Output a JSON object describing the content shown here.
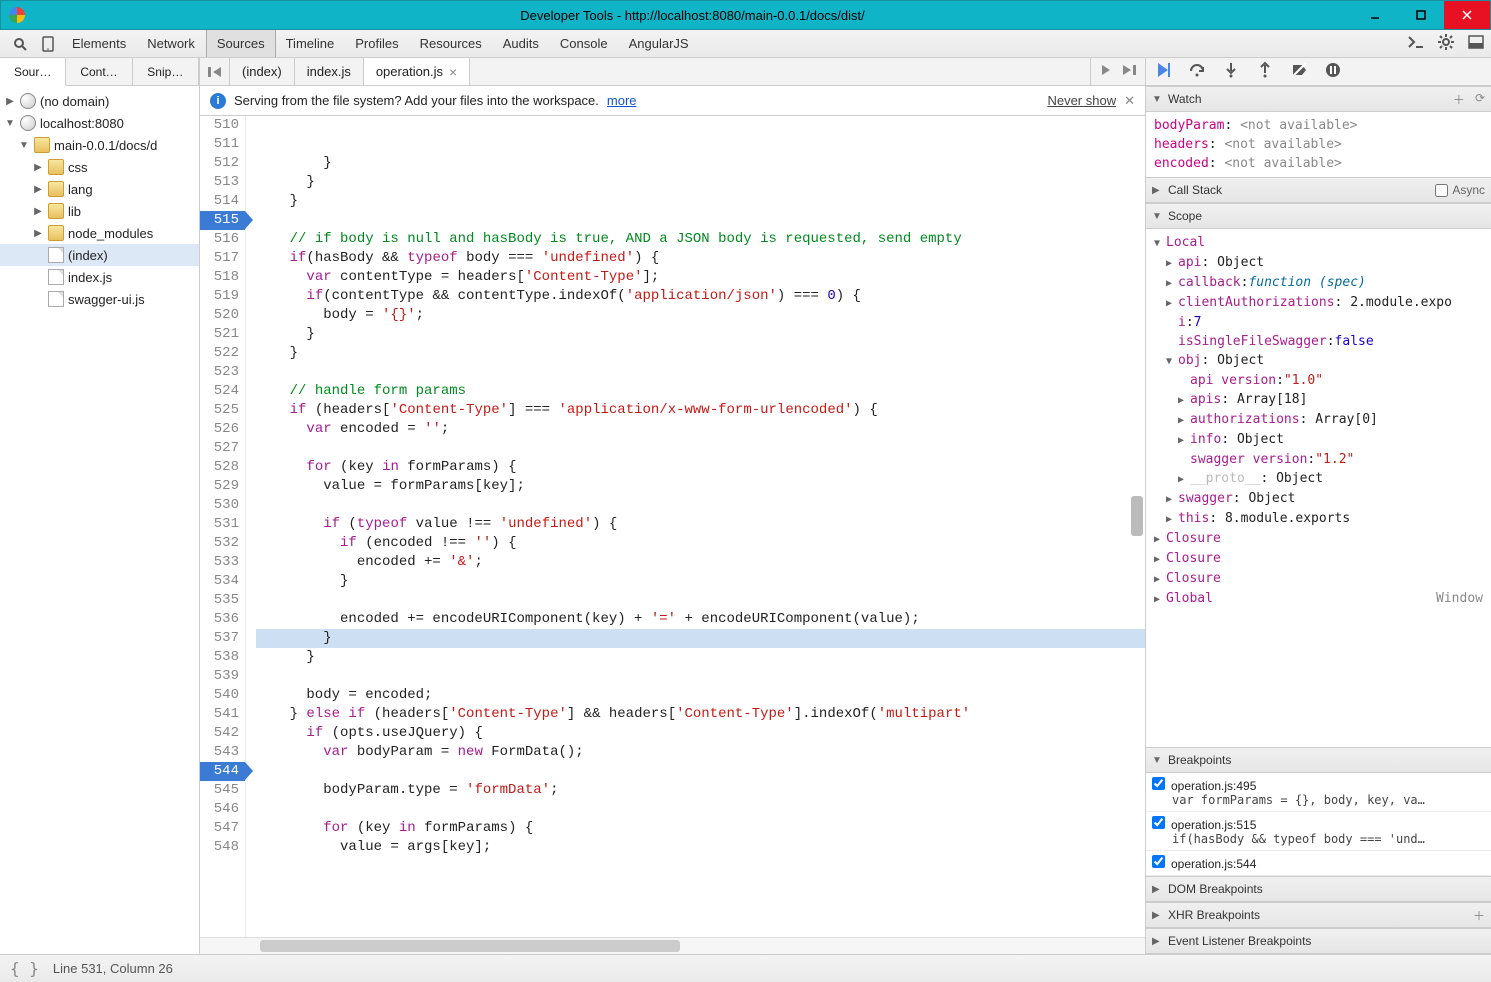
{
  "window": {
    "title": "Developer Tools - http://localhost:8080/main-0.0.1/docs/dist/"
  },
  "mainTabs": [
    "Elements",
    "Network",
    "Sources",
    "Timeline",
    "Profiles",
    "Resources",
    "Audits",
    "Console",
    "AngularJS"
  ],
  "mainTabActive": "Sources",
  "leftTabs": [
    "Sour…",
    "Cont…",
    "Snip…"
  ],
  "tree": {
    "noDomain": "(no domain)",
    "host": "localhost:8080",
    "folder": "main-0.0.1/docs/d",
    "subs": [
      "css",
      "lang",
      "lib",
      "node_modules"
    ],
    "files": [
      "(index)",
      "index.js",
      "swagger-ui.js"
    ],
    "selected": "(index)"
  },
  "fileTabs": [
    {
      "label": "(index)",
      "active": false,
      "closable": false
    },
    {
      "label": "index.js",
      "active": false,
      "closable": false
    },
    {
      "label": "operation.js",
      "active": true,
      "closable": true
    }
  ],
  "info": {
    "text": "Serving from the file system? Add your files into the workspace.",
    "more": "more",
    "never": "Never show"
  },
  "code": {
    "startLine": 510,
    "breakpoints": [
      515,
      544
    ],
    "highlight": 535,
    "lines": [
      {
        "n": 510,
        "h": "        }"
      },
      {
        "n": 511,
        "h": "      }"
      },
      {
        "n": 512,
        "h": "    }"
      },
      {
        "n": 513,
        "h": ""
      },
      {
        "n": 514,
        "h": "    <span class='cm'>// if body is null and hasBody is true, AND a JSON body is requested, send empty</span>"
      },
      {
        "n": 515,
        "h": "    <span class='kw'>if</span>(hasBody && <span class='kw'>typeof</span> body === <span class='str'>'undefined'</span>) {"
      },
      {
        "n": 516,
        "h": "      <span class='kw'>var</span> contentType = headers[<span class='str'>'Content-Type'</span>];"
      },
      {
        "n": 517,
        "h": "      <span class='kw'>if</span>(contentType && contentType.indexOf(<span class='str'>'application/json'</span>) === <span class='num'>0</span>) {"
      },
      {
        "n": 518,
        "h": "        body = <span class='str'>'{}'</span>;"
      },
      {
        "n": 519,
        "h": "      }"
      },
      {
        "n": 520,
        "h": "    }"
      },
      {
        "n": 521,
        "h": ""
      },
      {
        "n": 522,
        "h": "    <span class='cm'>// handle form params</span>"
      },
      {
        "n": 523,
        "h": "    <span class='kw'>if</span> (headers[<span class='str'>'Content-Type'</span>] === <span class='str'>'application/x-www-form-urlencoded'</span>) {"
      },
      {
        "n": 524,
        "h": "      <span class='kw'>var</span> encoded = <span class='str'>''</span>;"
      },
      {
        "n": 525,
        "h": ""
      },
      {
        "n": 526,
        "h": "      <span class='kw'>for</span> (key <span class='kw'>in</span> formParams) {"
      },
      {
        "n": 527,
        "h": "        value = formParams[key];"
      },
      {
        "n": 528,
        "h": ""
      },
      {
        "n": 529,
        "h": "        <span class='kw'>if</span> (<span class='kw'>typeof</span> value !== <span class='str'>'undefined'</span>) {"
      },
      {
        "n": 530,
        "h": "          <span class='kw'>if</span> (encoded !== <span class='str'>''</span>) {"
      },
      {
        "n": 531,
        "h": "            encoded += <span class='str'>'&'</span>;"
      },
      {
        "n": 532,
        "h": "          }"
      },
      {
        "n": 533,
        "h": ""
      },
      {
        "n": 534,
        "h": "          encoded += encodeURIComponent(key) + <span class='str'>'='</span> + encodeURIComponent(value);"
      },
      {
        "n": 535,
        "h": "        }"
      },
      {
        "n": 536,
        "h": "      }"
      },
      {
        "n": 537,
        "h": ""
      },
      {
        "n": 538,
        "h": "      body = encoded;"
      },
      {
        "n": 539,
        "h": "    } <span class='kw'>else if</span> (headers[<span class='str'>'Content-Type'</span>] && headers[<span class='str'>'Content-Type'</span>].indexOf(<span class='str'>'multipart'</span>"
      },
      {
        "n": 540,
        "h": "      <span class='kw'>if</span> (opts.useJQuery) {"
      },
      {
        "n": 541,
        "h": "        <span class='kw'>var</span> bodyParam = <span class='kw'>new</span> FormData();"
      },
      {
        "n": 542,
        "h": ""
      },
      {
        "n": 543,
        "h": "        bodyParam.type = <span class='str'>'formData'</span>;"
      },
      {
        "n": 544,
        "h": ""
      },
      {
        "n": 545,
        "h": "        <span class='kw'>for</span> (key <span class='kw'>in</span> formParams) {"
      },
      {
        "n": 546,
        "h": "          value = args[key];"
      },
      {
        "n": 547,
        "h": ""
      },
      {
        "n": 548,
        "h": ""
      }
    ]
  },
  "watch": [
    {
      "name": "bodyParam",
      "val": "<not available>"
    },
    {
      "name": "headers",
      "val": "<not available>"
    },
    {
      "name": "encoded",
      "val": "<not available>"
    }
  ],
  "callStack": {
    "header": "Call Stack",
    "async": "Async"
  },
  "scopeHeader": "Scope",
  "scope": [
    {
      "lvl": 0,
      "tw": "▼",
      "k": "Local",
      "v": "",
      "cls": ""
    },
    {
      "lvl": 1,
      "tw": "▶",
      "k": "api",
      "v": ": Object",
      "cls": "v-obj"
    },
    {
      "lvl": 1,
      "tw": "▶",
      "k": "callback",
      "v": ": ",
      "extra": "function (spec)",
      "cls": "v-fn"
    },
    {
      "lvl": 1,
      "tw": "▶",
      "k": "clientAuthorizations",
      "v": ": 2.module.expo",
      "cls": "v-obj"
    },
    {
      "lvl": 1,
      "tw": "",
      "k": "i",
      "v": ": ",
      "extra": "7",
      "cls": "v-num"
    },
    {
      "lvl": 1,
      "tw": "",
      "k": "isSingleFileSwagger",
      "v": ": ",
      "extra": "false",
      "cls": "v-bool"
    },
    {
      "lvl": 1,
      "tw": "▼",
      "k": "obj",
      "v": ": Object",
      "cls": "v-obj"
    },
    {
      "lvl": 2,
      "tw": "",
      "k": "api version",
      "v": ": ",
      "extra": "\"1.0\"",
      "cls": "v-str"
    },
    {
      "lvl": 2,
      "tw": "▶",
      "k": "apis",
      "v": ": Array[18]",
      "cls": "v-obj"
    },
    {
      "lvl": 2,
      "tw": "▶",
      "k": "authorizations",
      "v": ": Array[0]",
      "cls": "v-obj"
    },
    {
      "lvl": 2,
      "tw": "▶",
      "k": "info",
      "v": ": Object",
      "cls": "v-obj"
    },
    {
      "lvl": 2,
      "tw": "",
      "k": "swagger version",
      "v": ": ",
      "extra": "\"1.2\"",
      "cls": "v-str"
    },
    {
      "lvl": 2,
      "tw": "▶",
      "k": "__proto__",
      "v": ": Object",
      "cls": "v-obj",
      "dim": true
    },
    {
      "lvl": 1,
      "tw": "▶",
      "k": "swagger",
      "v": ": Object",
      "cls": "v-obj"
    },
    {
      "lvl": 1,
      "tw": "▶",
      "k": "this",
      "v": ": 8.module.exports",
      "cls": "v-obj"
    },
    {
      "lvl": 0,
      "tw": "▶",
      "k": "Closure",
      "v": "",
      "cls": ""
    },
    {
      "lvl": 0,
      "tw": "▶",
      "k": "Closure",
      "v": "",
      "cls": ""
    },
    {
      "lvl": 0,
      "tw": "▶",
      "k": "Closure",
      "v": "",
      "cls": ""
    },
    {
      "lvl": 0,
      "tw": "▶",
      "k": "Global",
      "v": "",
      "right": "Window",
      "cls": ""
    }
  ],
  "bpHeader": "Breakpoints",
  "breakpoints": [
    {
      "loc": "operation.js:495",
      "snip": "var formParams = {}, body, key, va…"
    },
    {
      "loc": "operation.js:515",
      "snip": "if(hasBody && typeof body === 'und…"
    },
    {
      "loc": "operation.js:544",
      "snip": ""
    }
  ],
  "otherSections": [
    "DOM Breakpoints",
    "XHR Breakpoints",
    "Event Listener Breakpoints"
  ],
  "watchHeader": "Watch",
  "status": {
    "pos": "Line 531, Column 26"
  }
}
